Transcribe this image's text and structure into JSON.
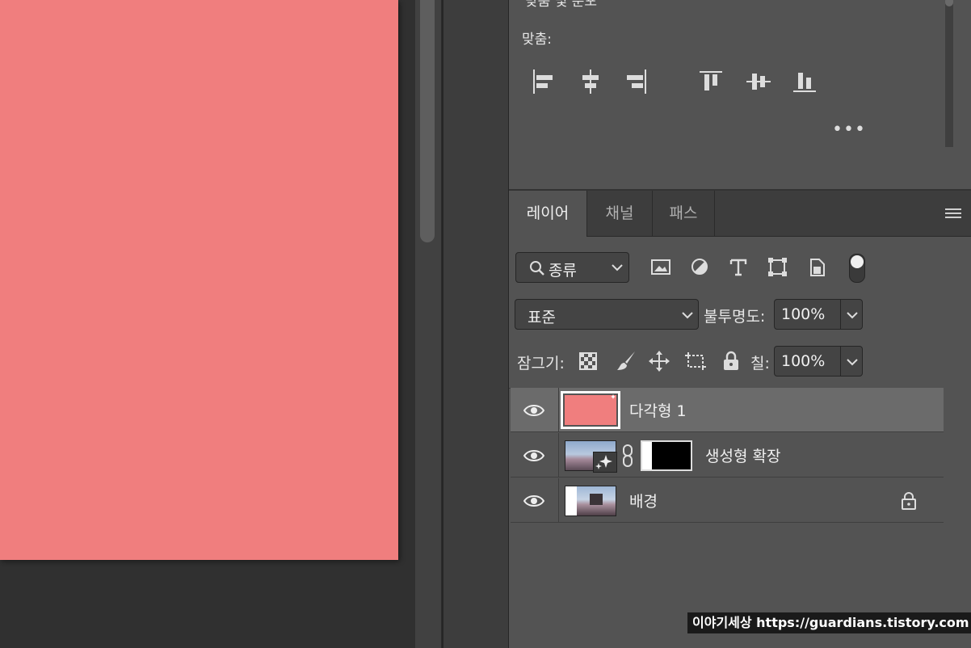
{
  "align_panel": {
    "title": "맞춤 및 분포",
    "align_label": "맞춤:",
    "align_buttons": [
      "align-left-edges-icon",
      "align-horizontal-centers-icon",
      "align-right-edges-icon",
      "align-top-edges-icon",
      "align-vertical-centers-icon",
      "align-bottom-edges-icon"
    ],
    "more_label": "•••"
  },
  "layers_panel": {
    "tabs": [
      {
        "label": "레이어",
        "active": true
      },
      {
        "label": "채널",
        "active": false
      },
      {
        "label": "패스",
        "active": false
      }
    ],
    "filter": {
      "label": "종류",
      "icons": [
        "image-filter-icon",
        "adjustment-filter-icon",
        "type-filter-icon",
        "shape-filter-icon",
        "smart-object-filter-icon"
      ]
    },
    "blend_mode": "표준",
    "opacity_label": "불투명도:",
    "opacity_value": "100%",
    "lock_label": "잠그기:",
    "lock_icons": [
      "lock-transparent-icon",
      "lock-image-icon",
      "lock-position-icon",
      "lock-artboard-icon",
      "lock-all-icon"
    ],
    "fill_label": "칠:",
    "fill_value": "100%",
    "layers": [
      {
        "name": "다각형 1",
        "selected": true,
        "visible": true,
        "type": "shape",
        "color": "#f07e7e"
      },
      {
        "name": "생성형 확장",
        "selected": false,
        "visible": true,
        "type": "generative",
        "has_mask": true
      },
      {
        "name": "배경",
        "selected": false,
        "visible": true,
        "type": "background",
        "locked": true
      }
    ]
  },
  "canvas": {
    "fill_color": "#f07e7e"
  },
  "watermark": "이야기세상 https://guardians.tistory.com"
}
